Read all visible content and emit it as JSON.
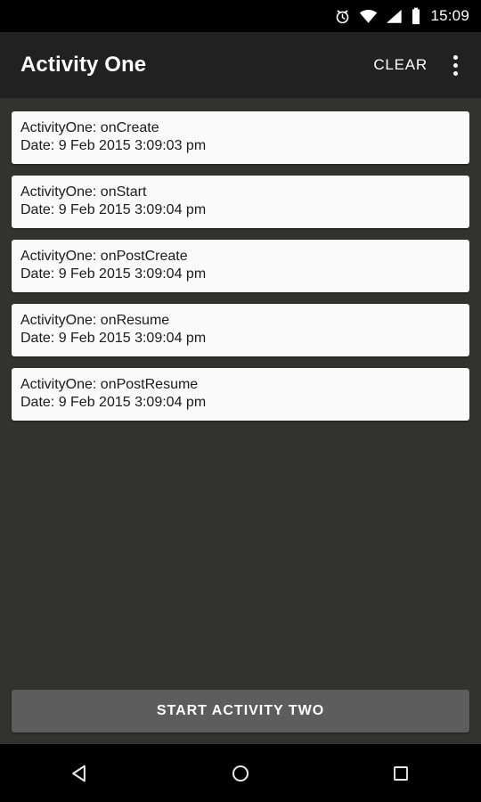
{
  "status_bar": {
    "time": "15:09",
    "icons": [
      {
        "name": "alarm-icon",
        "label": "alarm"
      },
      {
        "name": "wifi-icon",
        "label": "wifi"
      },
      {
        "name": "cell-signal-icon",
        "label": "signal"
      },
      {
        "name": "battery-icon",
        "label": "battery"
      }
    ],
    "background_color": "#000000"
  },
  "app_bar": {
    "title": "Activity One",
    "clear_label": "CLEAR",
    "overflow_label": "More options",
    "background_color": "#212121"
  },
  "content": {
    "background_color": "#323231",
    "card_color": "#fafafa",
    "log_entries": [
      {
        "event": "ActivityOne: onCreate",
        "date": "Date: 9 Feb 2015 3:09:03 pm"
      },
      {
        "event": "ActivityOne: onStart",
        "date": "Date: 9 Feb 2015 3:09:04 pm"
      },
      {
        "event": "ActivityOne: onPostCreate",
        "date": "Date: 9 Feb 2015 3:09:04 pm"
      },
      {
        "event": "ActivityOne: onResume",
        "date": "Date: 9 Feb 2015 3:09:04 pm"
      },
      {
        "event": "ActivityOne: onPostResume",
        "date": "Date: 9 Feb 2015 3:09:04 pm"
      }
    ]
  },
  "start_button": {
    "label": "START ACTIVITY TWO",
    "background_color": "#5d5d5d"
  },
  "nav_bar": {
    "background_color": "#000000",
    "buttons": [
      {
        "name": "back-icon",
        "label": "Back"
      },
      {
        "name": "home-icon",
        "label": "Home"
      },
      {
        "name": "recents-icon",
        "label": "Recent apps"
      }
    ]
  }
}
